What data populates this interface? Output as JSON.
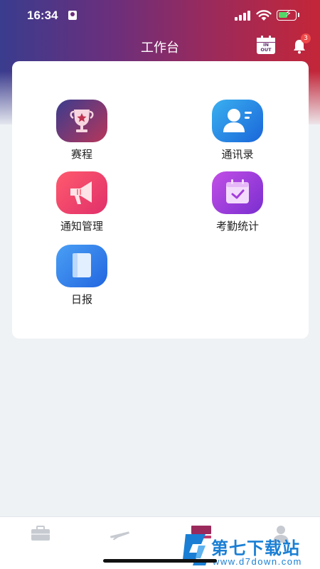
{
  "status_bar": {
    "time": "16:34"
  },
  "header": {
    "title": "工作台",
    "checkin_icon_text_top": "IN",
    "checkin_icon_text_bottom": "OUT",
    "notification_count": "3"
  },
  "grid": {
    "items": [
      {
        "label": "赛程",
        "icon": "trophy-icon"
      },
      {
        "label": "通讯录",
        "icon": "contacts-icon"
      },
      {
        "label": "通知管理",
        "icon": "megaphone-icon"
      },
      {
        "label": "考勤统计",
        "icon": "calendar-check-icon"
      },
      {
        "label": "日报",
        "icon": "document-icon"
      }
    ]
  },
  "tab_bar": {
    "tabs": [
      {
        "icon": "briefcase-icon",
        "active": false
      },
      {
        "icon": "airplane-icon",
        "active": false
      },
      {
        "icon": "workbench-icon",
        "active": true
      },
      {
        "icon": "user-icon",
        "active": false
      }
    ]
  },
  "watermark": {
    "title": "第七下载站",
    "url": "www.d7down.com"
  },
  "colors": {
    "header_start": "#3a3c8e",
    "header_end": "#c42638",
    "badge": "#f04a4a",
    "watermark": "#1a7fd4"
  }
}
